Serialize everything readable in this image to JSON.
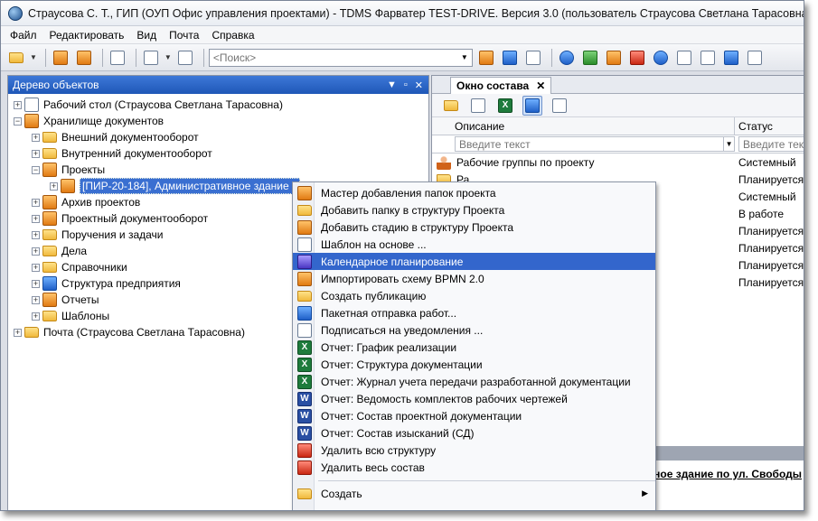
{
  "window": {
    "title": "Страусова С. Т., ГИП (ОУП Офис управления проектами) - TDMS Фарватер TEST-DRIVE. Версия 3.0 (пользователь Страусова Светлана Тарасовна)"
  },
  "menubar": {
    "items": [
      "Файл",
      "Редактировать",
      "Вид",
      "Почта",
      "Справка"
    ]
  },
  "toolbar": {
    "search_placeholder": "<Поиск>"
  },
  "left_pane": {
    "title": "Дерево объектов",
    "tree": [
      {
        "label": "Рабочий стол (Страусова Светлана Тарасовна)",
        "icon": "desktop-icon",
        "level": 0,
        "expander": "+"
      },
      {
        "label": "Хранилище документов",
        "icon": "storage-icon",
        "level": 0,
        "expander": "−"
      },
      {
        "label": "Внешний документооборот",
        "icon": "folder-icon",
        "level": 1,
        "expander": "+"
      },
      {
        "label": "Внутренний документооборот",
        "icon": "folder-icon",
        "level": 1,
        "expander": "+"
      },
      {
        "label": "Проекты",
        "icon": "projects-folder-icon",
        "level": 1,
        "expander": "−"
      },
      {
        "label": "[ПИР-20-184], Административное здание п",
        "icon": "project-icon",
        "level": 2,
        "expander": "+",
        "selected": true
      },
      {
        "label": "Архив проектов",
        "icon": "archive-icon",
        "level": 1,
        "expander": "+"
      },
      {
        "label": "Проектный документооборот",
        "icon": "chart-folder-icon",
        "level": 1,
        "expander": "+"
      },
      {
        "label": "Поручения и задачи",
        "icon": "folder-icon",
        "level": 1,
        "expander": "+"
      },
      {
        "label": "Дела",
        "icon": "folder-icon",
        "level": 1,
        "expander": "+"
      },
      {
        "label": "Справочники",
        "icon": "folder-icon",
        "level": 1,
        "expander": "+"
      },
      {
        "label": "Структура предприятия",
        "icon": "org-structure-icon",
        "level": 1,
        "expander": "+"
      },
      {
        "label": "Отчеты",
        "icon": "reports-icon",
        "level": 1,
        "expander": "+"
      },
      {
        "label": "Шаблоны",
        "icon": "templates-icon",
        "level": 1,
        "expander": "+"
      },
      {
        "label": "Почта (Страусова Светлана Тарасовна)",
        "icon": "mail-icon",
        "level": 0,
        "expander": "+"
      }
    ]
  },
  "right_pane": {
    "tab_label": "Окно состава",
    "columns": [
      "Описание",
      "Статус"
    ],
    "filter_placeholder": "Введите текст",
    "filter_placeholder_status": "Введите текс",
    "rows": [
      {
        "desc": "Рабочие группы по проекту",
        "status": "Системный",
        "icon": "workgroup-icon"
      },
      {
        "desc": "Ра",
        "status": "Планируется",
        "icon": "folder-icon"
      },
      {
        "desc": "",
        "status": "Системный",
        "icon": "folder-icon"
      },
      {
        "desc": "",
        "status": "В работе",
        "icon": "folder-icon"
      },
      {
        "desc": "",
        "status": "Планируется",
        "icon": "folder-icon"
      },
      {
        "desc": "",
        "status": "Планируется",
        "icon": "folder-icon"
      },
      {
        "desc": "",
        "status": "Планируется",
        "icon": "folder-icon"
      },
      {
        "desc": "",
        "status": "Планируется",
        "icon": "folder-icon"
      }
    ],
    "bottom_link": "ное здание по ул. Свободы"
  },
  "context_menu": {
    "items": [
      {
        "label": "Мастер добавления папок проекта",
        "icon": "wizard-folder-icon",
        "cls": "orange"
      },
      {
        "label": "Добавить папку в структуру Проекта",
        "icon": "folder-icon",
        "cls": "folder"
      },
      {
        "label": "Добавить стадию в структуру Проекта",
        "icon": "stage-icon",
        "cls": "orange"
      },
      {
        "label": "Шаблон на основе ...",
        "icon": "template-icon",
        "cls": "doc"
      },
      {
        "label": "Календарное планирование",
        "icon": "calendar-icon",
        "cls": "purple",
        "highlight": true
      },
      {
        "label": "Импортировать схему BPMN 2.0",
        "icon": "import-icon",
        "cls": "orange"
      },
      {
        "label": "Создать публикацию",
        "icon": "publication-icon",
        "cls": "folder"
      },
      {
        "label": "Пакетная отправка работ...",
        "icon": "batch-send-icon",
        "cls": "blue"
      },
      {
        "label": "Подписаться на уведомления ...",
        "icon": "subscribe-icon",
        "cls": "doc"
      },
      {
        "label": "Отчет: График реализации",
        "icon": "excel-icon",
        "cls": "xl"
      },
      {
        "label": "Отчет: Структура документации",
        "icon": "excel-icon",
        "cls": "xl"
      },
      {
        "label": "Отчет: Журнал учета передачи разработанной документации",
        "icon": "excel-icon",
        "cls": "xl"
      },
      {
        "label": "Отчет: Ведомость комплектов рабочих чертежей",
        "icon": "word-icon",
        "cls": "wd"
      },
      {
        "label": "Отчет: Состав проектной документации",
        "icon": "word-icon",
        "cls": "wd"
      },
      {
        "label": "Отчет: Состав изысканий (СД)",
        "icon": "word-icon",
        "cls": "wd"
      },
      {
        "label": "Удалить всю структуру",
        "icon": "delete-structure-icon",
        "cls": "red"
      },
      {
        "label": "Удалить весь состав",
        "icon": "delete-content-icon",
        "cls": "red"
      }
    ],
    "create_label": "Создать"
  }
}
